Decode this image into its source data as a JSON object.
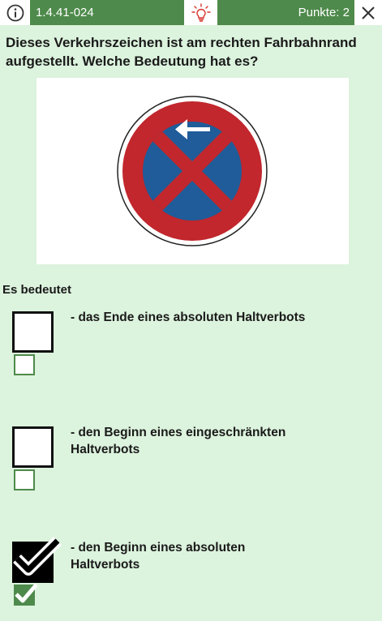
{
  "topbar": {
    "info_icon": "info-circle-icon",
    "question_id": "1.4.41-024",
    "hint_icon": "lightbulb-icon",
    "points_label": "Punkte: 2",
    "close_icon": "close-icon"
  },
  "question": {
    "text": "Dieses Verkehrszeichen ist am rechten Fahrbahnrand aufgestellt. Welche Bedeutung hat es?"
  },
  "sign": {
    "icon": "absolute-no-stopping-sign-with-left-arrow",
    "colors": {
      "ring": "#c1272d",
      "field": "#1f5c99",
      "arrow": "#ffffff"
    }
  },
  "answers": {
    "lead": "Es bedeutet",
    "options": [
      {
        "text": "- das Ende eines absoluten Haltverbots",
        "checked": false,
        "solution_checked": false
      },
      {
        "text": "- den Beginn eines eingeschränkten Haltverbots",
        "checked": false,
        "solution_checked": false
      },
      {
        "text": "- den Beginn eines absoluten Haltverbots",
        "checked": true,
        "solution_checked": true
      }
    ]
  },
  "colors": {
    "background": "#dcf3dd",
    "accent": "#4e8a4b",
    "hint": "#d9342b"
  }
}
